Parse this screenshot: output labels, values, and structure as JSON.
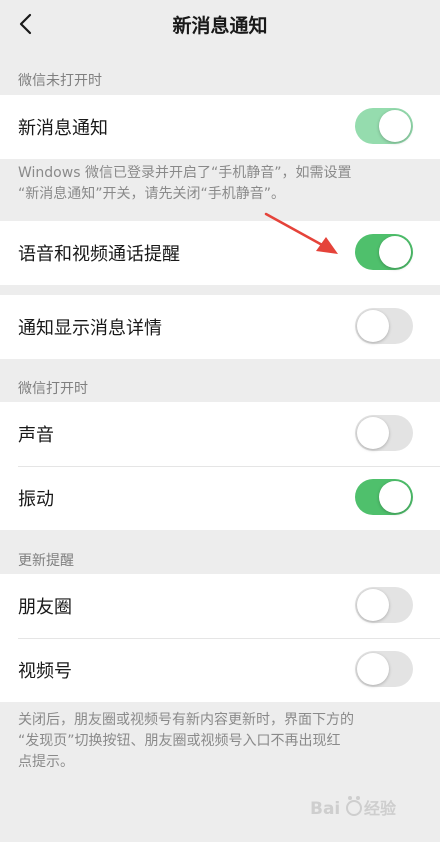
{
  "nav": {
    "back_icon": "chevron-left-icon",
    "title": "新消息通知"
  },
  "sections": {
    "closed_header": "微信未打开时",
    "open_header": "微信打开时",
    "updates_header": "更新提醒"
  },
  "settings": {
    "new_message": {
      "label": "新消息通知",
      "on": true,
      "dimmed": true
    },
    "voice_video": {
      "label": "语音和视频通话提醒",
      "on": true
    },
    "show_details": {
      "label": "通知显示消息详情",
      "on": false
    },
    "sound": {
      "label": "声音",
      "on": false
    },
    "vibrate": {
      "label": "振动",
      "on": true
    },
    "moments": {
      "label": "朋友圈",
      "on": false
    },
    "channels": {
      "label": "视频号",
      "on": false
    }
  },
  "notes": {
    "windows_note": "Windows 微信已登录并开启了“手机静音”，如需设置\n“新消息通知”开关，请先关闭“手机静音”。",
    "updates_note": "关闭后，朋友圈或视频号有新内容更新时，界面下方的\n“发现页”切换按钮、朋友圈或视频号入口不再出现红\n点提示。"
  },
  "colors": {
    "toggle_on": "#4fc06c",
    "toggle_on_dimmed": "#95dcae",
    "toggle_off": "#e3e3e3",
    "background": "#ededed",
    "annotation_arrow": "#e5433a"
  },
  "watermark": {
    "text": "Baidu经验"
  }
}
